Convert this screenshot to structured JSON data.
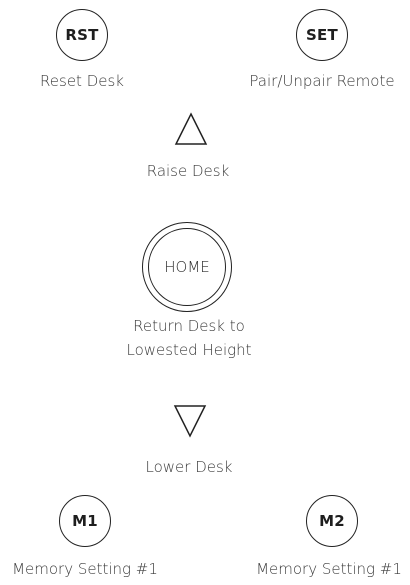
{
  "buttons": {
    "rst": {
      "text": "RST",
      "label": "Reset Desk"
    },
    "set": {
      "text": "SET",
      "label": "Pair/Unpair Remote"
    },
    "raise": {
      "icon": "up-triangle-icon",
      "label": "Raise Desk"
    },
    "home": {
      "text": "HOME",
      "label_line1": "Return Desk to",
      "label_line2": "Lowested Height"
    },
    "lower": {
      "icon": "down-triangle-icon",
      "label": "Lower Desk"
    },
    "m1": {
      "text": "M1",
      "label": "Memory Setting #1"
    },
    "m2": {
      "text": "M2",
      "label": "Memory Setting #1"
    }
  }
}
